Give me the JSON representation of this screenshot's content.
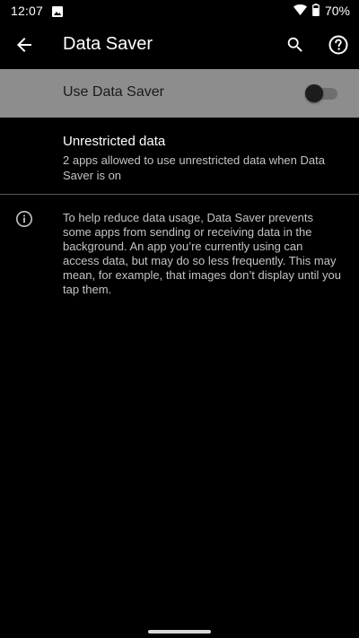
{
  "status_bar": {
    "time": "12:07",
    "battery": "70%",
    "icons": [
      "image-notification-icon",
      "wifi-icon",
      "battery-icon"
    ]
  },
  "app_bar": {
    "title": "Data Saver",
    "back_icon": "arrow-back-icon",
    "search_icon": "search-icon",
    "help_icon": "help-icon"
  },
  "master_switch": {
    "label": "Use Data Saver",
    "checked": false
  },
  "unrestricted": {
    "title": "Unrestricted data",
    "summary": "2 apps allowed to use unrestricted data when Data Saver is on"
  },
  "footer": {
    "icon": "info-icon",
    "text": "To help reduce data usage, Data Saver prevents some apps from sending or receiving data in the background. An app you’re currently using can access data, but may do so less frequently. This may mean, for example, that images don’t display until you tap them."
  },
  "colors": {
    "background": "#000000",
    "highlight_row": "#8d8d8d",
    "primary_text": "#ffffff",
    "secondary_text": "#c4c4c4",
    "divider": "#5a5a5a"
  }
}
